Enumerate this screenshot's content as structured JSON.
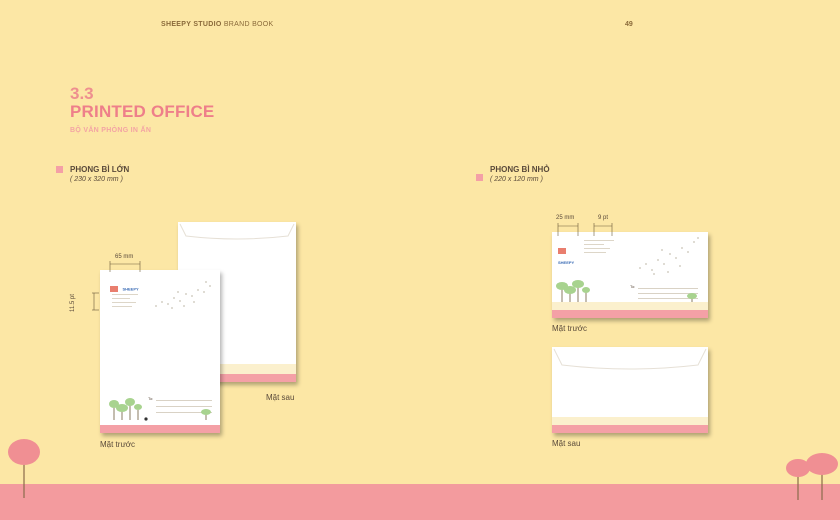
{
  "header": {
    "studio": "SHEEPY STUDIO",
    "book": "BRAND BOOK",
    "page": "49"
  },
  "section": {
    "number": "3.3",
    "title": "PRINTED OFFICE",
    "subtitle": "BỘ VĂN PHÒNG IN ẤN"
  },
  "large_envelope": {
    "title": "PHONG BÌ LỚN",
    "size": "( 230 x 320 mm )",
    "front_caption": "Mặt trước",
    "back_caption": "Mặt sau",
    "dim_width": "65 mm",
    "dim_height": "11.5 pt",
    "logo_text": "SHEEPY",
    "to_label": "To:"
  },
  "small_envelope": {
    "title": "PHONG BÌ NHỎ",
    "size": "( 220 x 120 mm )",
    "front_caption": "Mặt trước",
    "back_caption": "Mặt sau",
    "dim_left": "25 mm",
    "dim_pt": "9 pt",
    "logo_text": "SHEEPY",
    "to_label": "To:"
  },
  "colors": {
    "background": "#fce7a5",
    "accent_pink": "#f4a0a6",
    "title_pink": "#ee7f8a",
    "tree_green": "#9fd089"
  }
}
